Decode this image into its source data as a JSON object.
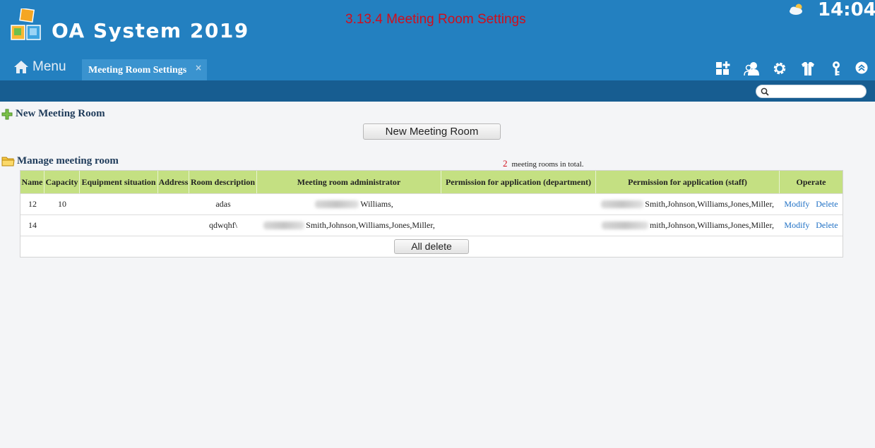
{
  "app": {
    "title": "OA System 2019",
    "page_caption": "3.13.4 Meeting Room Settings",
    "clock": "14:04"
  },
  "nav": {
    "menu_label": "Menu",
    "active_tab": "Meeting Room Settings",
    "tab_close": "×",
    "toolbar_icons": [
      "grid-add-icon",
      "users-icon",
      "gear-icon",
      "shirt-icon",
      "key-icon",
      "collapse-up-icon"
    ]
  },
  "search": {
    "placeholder": "",
    "value": ""
  },
  "new_section": {
    "title": "New Meeting Room",
    "button_label": "New Meeting Room"
  },
  "manage_section": {
    "title": "Manage meeting room",
    "total_count": "2",
    "total_text": "meeting rooms in total."
  },
  "table": {
    "columns": [
      "Name",
      "Capacity",
      "Equipment situation",
      "Address",
      "Room description",
      "Meeting room administrator",
      "Permission for application (department)",
      "Permission for application (staff)",
      "Operate"
    ],
    "rows": [
      {
        "name": "12",
        "capacity": "10",
        "equipment": "",
        "address": "",
        "description": "adas",
        "administrator": "Williams,",
        "perm_department": "",
        "perm_staff": "Smith,Johnson,Williams,Jones,Miller,",
        "modify": "Modify",
        "delete": "Delete"
      },
      {
        "name": "14",
        "capacity": "",
        "equipment": "",
        "address": "",
        "description": "qdwqhf\\",
        "administrator": "Smith,Johnson,Williams,Jones,Miller,",
        "perm_department": "",
        "perm_staff": "mith,Johnson,Williams,Jones,Miller,",
        "modify": "Modify",
        "delete": "Delete"
      }
    ],
    "all_delete_label": "All delete"
  },
  "colors": {
    "header_blue": "#2380c0",
    "subbar_blue": "#175d91",
    "table_header_green": "#c4e082",
    "caption_red": "#d10d1b",
    "link_blue": "#1d6fc4"
  }
}
